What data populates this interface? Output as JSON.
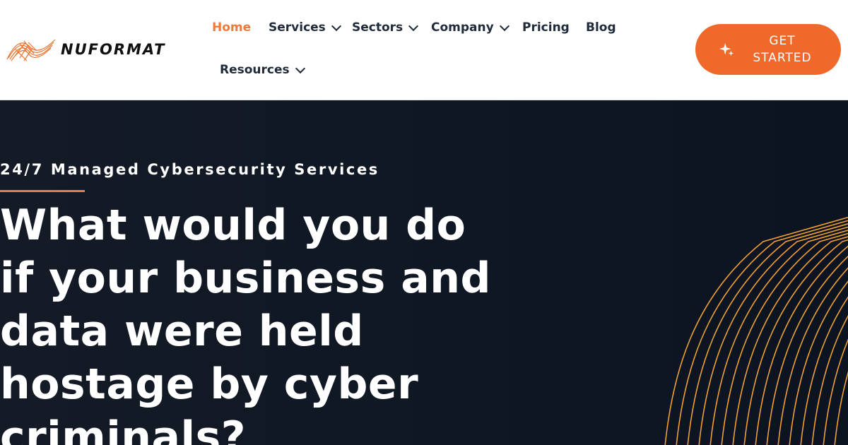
{
  "brand": {
    "name": "NUFORMAT",
    "accent_color": "#ef6a2a"
  },
  "nav": {
    "items": [
      {
        "label": "Home",
        "active": true,
        "has_dropdown": false
      },
      {
        "label": "Services",
        "active": false,
        "has_dropdown": true
      },
      {
        "label": "Sectors",
        "active": false,
        "has_dropdown": true
      },
      {
        "label": "Company",
        "active": false,
        "has_dropdown": true
      },
      {
        "label": "Pricing",
        "active": false,
        "has_dropdown": false
      },
      {
        "label": "Blog",
        "active": false,
        "has_dropdown": false
      },
      {
        "label": "Resources",
        "active": false,
        "has_dropdown": true
      }
    ]
  },
  "cta": {
    "label": "GET STARTED",
    "icon": "sparkle-icon"
  },
  "hero": {
    "eyebrow": "24/7 Managed Cybersecurity Services",
    "headline": "What would you do if your business and data were held hostage by cyber criminals?",
    "background_color": "#0f1724",
    "decoration": "orange-wave-lines"
  }
}
